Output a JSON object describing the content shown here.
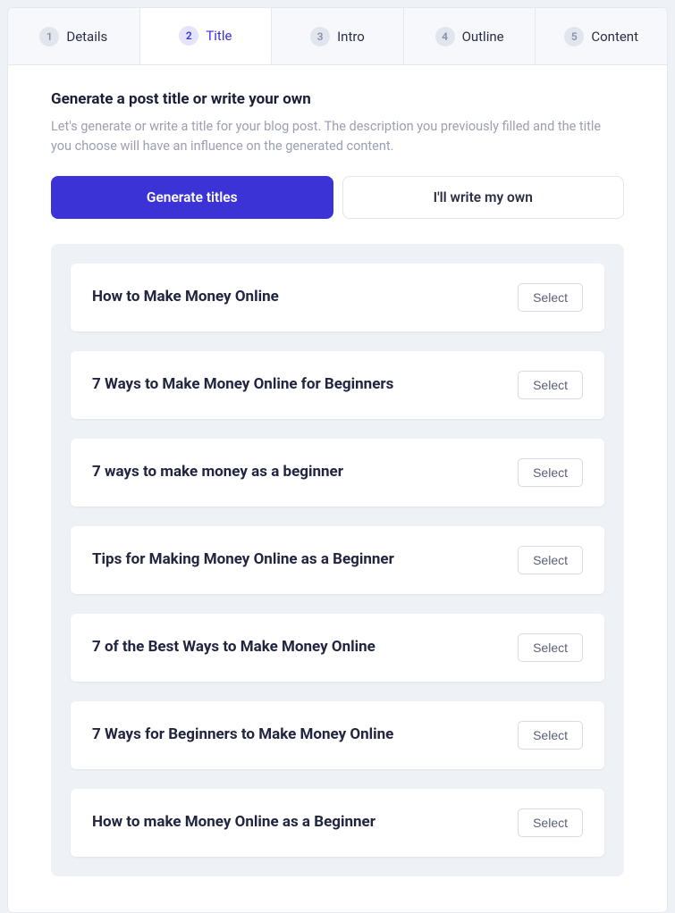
{
  "tabs": [
    {
      "num": "1",
      "label": "Details"
    },
    {
      "num": "2",
      "label": "Title"
    },
    {
      "num": "3",
      "label": "Intro"
    },
    {
      "num": "4",
      "label": "Outline"
    },
    {
      "num": "5",
      "label": "Content"
    }
  ],
  "active_tab_index": 1,
  "heading": "Generate a post title or write your own",
  "subtext": "Let's generate or write a title for your blog post. The description you previously filled and the title you choose will have an influence on the generated content.",
  "toggle": {
    "generate": "Generate titles",
    "write": "I'll write my own"
  },
  "select_label": "Select",
  "suggestions": [
    "How to Make Money Online",
    "7 Ways to Make Money Online for Beginners",
    "7 ways to make money as a beginner",
    "Tips for Making Money Online as a Beginner",
    "7 of the Best Ways to Make Money Online",
    "7 Ways for Beginners to Make Money Online",
    "How to make Money Online as a Beginner"
  ]
}
